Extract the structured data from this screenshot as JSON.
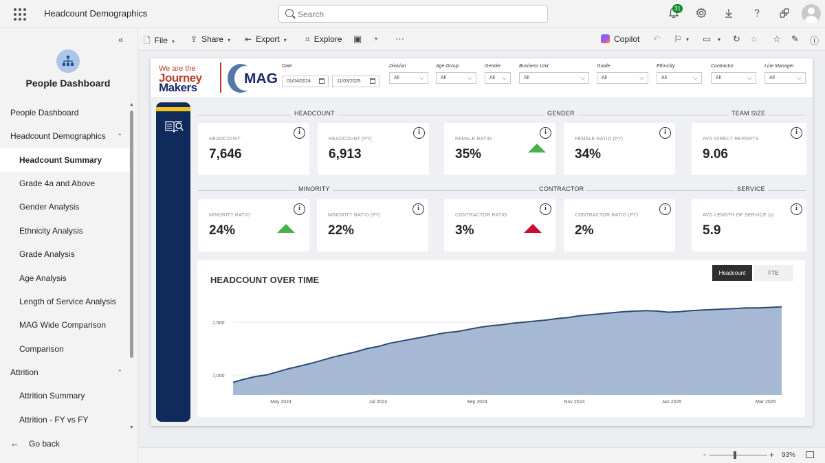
{
  "app": {
    "report_title": "Headcount Demographics",
    "search_placeholder": "Search",
    "notifications_count": "31"
  },
  "nav": {
    "app_name": "People Dashboard",
    "items": [
      {
        "label": "People Dashboard",
        "level": 1
      },
      {
        "label": "Headcount Demographics",
        "level": 1,
        "expanded": true
      },
      {
        "label": "Headcount Summary",
        "level": 2,
        "active": true
      },
      {
        "label": "Grade 4a and Above",
        "level": 2
      },
      {
        "label": "Gender Analysis",
        "level": 2
      },
      {
        "label": "Ethnicity Analysis",
        "level": 2
      },
      {
        "label": "Grade Analysis",
        "level": 2
      },
      {
        "label": "Age Analysis",
        "level": 2
      },
      {
        "label": "Length of Service Analysis",
        "level": 2
      },
      {
        "label": "MAG Wide Comparison",
        "level": 2
      },
      {
        "label": "Comparison",
        "level": 2
      },
      {
        "label": "Attrition",
        "level": 1,
        "expanded": true
      },
      {
        "label": "Attrition Summary",
        "level": 2
      },
      {
        "label": "Attrition - FY vs FY",
        "level": 2
      }
    ],
    "go_back": "Go back"
  },
  "toolbar": {
    "file": "File",
    "share": "Share",
    "export": "Export",
    "explore": "Explore",
    "copilot": "Copilot"
  },
  "report": {
    "logo": {
      "line1": "We are the",
      "line2": "Journey",
      "line3": "Makers",
      "brand": "MAG"
    },
    "slicers": {
      "date_label": "Date",
      "date_from": "01/04/2024",
      "date_to": "11/03/2025",
      "division": {
        "label": "Division",
        "value": "All"
      },
      "age_group": {
        "label": "Age Group",
        "value": "All"
      },
      "gender": {
        "label": "Gender",
        "value": "All"
      },
      "business_unit": {
        "label": "Business Unit",
        "value": "All"
      },
      "grade": {
        "label": "Grade",
        "value": "All"
      },
      "ethnicity": {
        "label": "Ethnicity",
        "value": "All"
      },
      "contractor": {
        "label": "Contractor",
        "value": "All"
      },
      "line_manager": {
        "label": "Line Manager",
        "value": "All"
      }
    },
    "sections": {
      "headcount": "HEADCOUNT",
      "gender": "GENDER",
      "team_size": "TEAM SIZE",
      "minority": "MINORITY",
      "contractor": "CONTRACTOR",
      "service": "SERVICE"
    },
    "kpis": {
      "headcount": {
        "label": "HEADCOUNT",
        "value": "7,646"
      },
      "headcount_py": {
        "label": "HEADCOUNT (PY)",
        "value": "6,913"
      },
      "female_ratio": {
        "label": "FEMALE RATIO",
        "value": "35%",
        "trend": "up"
      },
      "female_ratio_py": {
        "label": "FEMALE RATIO (PY)",
        "value": "34%"
      },
      "avg_direct_reports": {
        "label": "AVG DIRECT REPORTS",
        "value": "9.06"
      },
      "minority_ratio": {
        "label": "MINORITY RATIO",
        "value": "24%",
        "trend": "up"
      },
      "minority_ratio_py": {
        "label": "MINORITY RATIO (PY)",
        "value": "22%"
      },
      "contractor_ratio": {
        "label": "CONTRACTOR RATIO",
        "value": "3%",
        "trend": "up-red"
      },
      "contractor_ratio_py": {
        "label": "CONTRACTOR RATIO (PY)",
        "value": "2%"
      },
      "avg_length_of_service": {
        "label": "AVG LENGTH OF SERVICE (y)",
        "value": "5.9"
      }
    },
    "chart_toggle": {
      "headcount": "Headcount",
      "fte": "FTE",
      "selected": "Headcount"
    },
    "info_glyph": "i"
  },
  "chart_data": {
    "type": "area",
    "title": "HEADCOUNT OVER TIME",
    "xlabel": "",
    "ylabel": "",
    "x_tick_labels": [
      "May 2024",
      "Jul 2024",
      "Sep 2024",
      "Nov 2024",
      "Jan 2025",
      "Mar 2025"
    ],
    "y_tick_labels": [
      "7,000",
      "7,500"
    ],
    "ylim": [
      6810,
      7800
    ],
    "x_range": [
      "2024-04-01",
      "2025-03-11"
    ],
    "grid": true,
    "colors": {
      "fill": "#a6b9d4",
      "line": "#2d4a74"
    },
    "x": [
      "2024-04-01",
      "2024-04-08",
      "2024-04-15",
      "2024-04-22",
      "2024-04-29",
      "2024-05-06",
      "2024-05-13",
      "2024-05-20",
      "2024-05-27",
      "2024-06-03",
      "2024-06-10",
      "2024-06-17",
      "2024-06-24",
      "2024-07-01",
      "2024-07-08",
      "2024-07-15",
      "2024-07-22",
      "2024-07-29",
      "2024-08-05",
      "2024-08-12",
      "2024-08-19",
      "2024-08-26",
      "2024-09-02",
      "2024-09-09",
      "2024-09-16",
      "2024-09-23",
      "2024-09-30",
      "2024-10-07",
      "2024-10-14",
      "2024-10-21",
      "2024-10-28",
      "2024-11-04",
      "2024-11-11",
      "2024-11-18",
      "2024-11-25",
      "2024-12-02",
      "2024-12-09",
      "2024-12-16",
      "2024-12-23",
      "2024-12-30",
      "2025-01-06",
      "2025-01-13",
      "2025-01-20",
      "2025-01-27",
      "2025-02-03",
      "2025-02-10",
      "2025-02-17",
      "2025-02-24",
      "2025-03-03",
      "2025-03-11"
    ],
    "values": [
      6930,
      6960,
      6985,
      7000,
      7030,
      7060,
      7085,
      7110,
      7140,
      7170,
      7195,
      7220,
      7250,
      7270,
      7300,
      7320,
      7340,
      7360,
      7380,
      7400,
      7410,
      7430,
      7450,
      7465,
      7475,
      7490,
      7500,
      7510,
      7520,
      7535,
      7545,
      7560,
      7570,
      7580,
      7590,
      7600,
      7605,
      7610,
      7605,
      7595,
      7600,
      7610,
      7615,
      7620,
      7625,
      7630,
      7635,
      7635,
      7640,
      7646
    ]
  },
  "status": {
    "zoom": "93%"
  }
}
